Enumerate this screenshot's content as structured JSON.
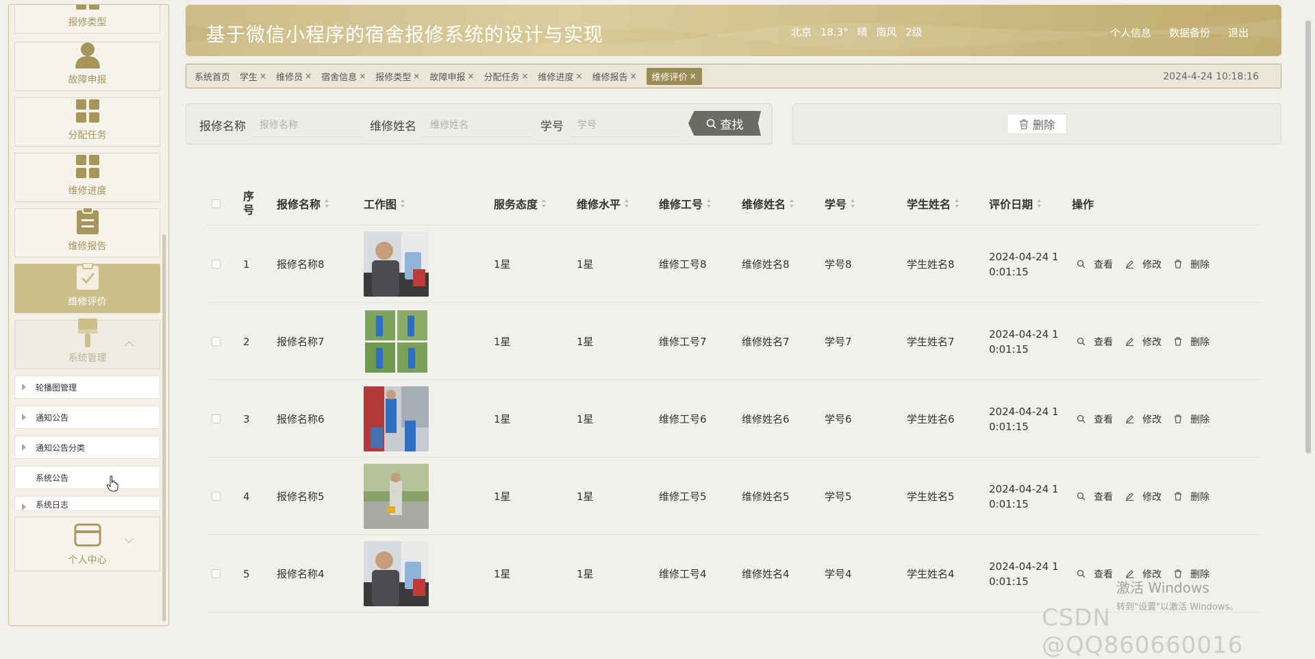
{
  "header": {
    "title": "基于微信小程序的宿舍报修系统的设计与实现",
    "weather": [
      "北京",
      "18.3°",
      "晴",
      "南风",
      "2级"
    ],
    "links": [
      "个人信息",
      "数据备份",
      "退出"
    ]
  },
  "sidebar": {
    "cards": [
      {
        "label": "报修类型",
        "icon": "grid-icon"
      },
      {
        "label": "故障申报",
        "icon": "user-icon"
      },
      {
        "label": "分配任务",
        "icon": "grid-icon"
      },
      {
        "label": "维修进度",
        "icon": "grid-icon"
      },
      {
        "label": "维修报告",
        "icon": "clipboard-icon"
      },
      {
        "label": "维修评价",
        "icon": "check-clipboard-icon",
        "active": true
      },
      {
        "label": "系统管理",
        "icon": "brush-icon",
        "expanded": true
      }
    ],
    "sub_items": [
      "轮播图管理",
      "通知公告",
      "通知公告分类",
      "系统公告",
      "系统日志"
    ],
    "bottom_card": {
      "label": "个人中心",
      "icon": "card-icon"
    }
  },
  "tabs": {
    "items": [
      {
        "label": "系统首页",
        "closable": false
      },
      {
        "label": "学生",
        "closable": true
      },
      {
        "label": "维修员",
        "closable": true
      },
      {
        "label": "宿舍信息",
        "closable": true
      },
      {
        "label": "报修类型",
        "closable": true
      },
      {
        "label": "故障申报",
        "closable": true
      },
      {
        "label": "分配任务",
        "closable": true
      },
      {
        "label": "维修进度",
        "closable": true
      },
      {
        "label": "维修报告",
        "closable": true
      },
      {
        "label": "维修评价",
        "closable": true,
        "active": true
      }
    ],
    "close_glyph": "×",
    "datetime": "2024-4-24 10:18:16"
  },
  "search": {
    "fields": [
      {
        "label": "报修名称",
        "placeholder": "报修名称"
      },
      {
        "label": "维修姓名",
        "placeholder": "维修姓名"
      },
      {
        "label": "学号",
        "placeholder": "学号"
      }
    ],
    "button": "查找"
  },
  "actions": {
    "delete": "删除"
  },
  "table": {
    "columns": [
      "序号",
      "报修名称",
      "工作图",
      "服务态度",
      "维修水平",
      "维修工号",
      "维修姓名",
      "学号",
      "学生姓名",
      "评价日期",
      "操作"
    ],
    "row_actions": [
      "查看",
      "修改",
      "删除"
    ],
    "rows": [
      {
        "no": "1",
        "name": "报修名称8",
        "attitude": "1星",
        "level": "1星",
        "staff_no": "维修工号8",
        "staff_name": "维修姓名8",
        "student_no": "学号8",
        "student_name": "学生姓名8",
        "date_line1": "2024-04-24 1",
        "date_line2": "0:01:15",
        "image": "repairman-phone"
      },
      {
        "no": "2",
        "name": "报修名称7",
        "attitude": "1星",
        "level": "1星",
        "staff_no": "维修工号7",
        "staff_name": "维修姓名7",
        "student_no": "学号7",
        "student_name": "学生姓名7",
        "date_line1": "2024-04-24 1",
        "date_line2": "0:01:15",
        "image": "workers-collage"
      },
      {
        "no": "3",
        "name": "报修名称6",
        "attitude": "1星",
        "level": "1星",
        "staff_no": "维修工号6",
        "staff_name": "维修姓名6",
        "student_no": "学号6",
        "student_name": "学生姓名6",
        "date_line1": "2024-04-24 1",
        "date_line2": "0:01:15",
        "image": "workers-street"
      },
      {
        "no": "4",
        "name": "报修名称5",
        "attitude": "1星",
        "level": "1星",
        "staff_no": "维修工号5",
        "staff_name": "维修姓名5",
        "student_no": "学号5",
        "student_name": "学生姓名5",
        "date_line1": "2024-04-24 1",
        "date_line2": "0:01:15",
        "image": "worker-walking"
      },
      {
        "no": "5",
        "name": "报修名称4",
        "attitude": "1星",
        "level": "1星",
        "staff_no": "维修工号4",
        "staff_name": "维修姓名4",
        "student_no": "学号4",
        "student_name": "学生姓名4",
        "date_line1": "2024-04-24 1",
        "date_line2": "0:01:15",
        "image": "repairman-phone"
      }
    ]
  },
  "overlay": {
    "activate_title": "激活 Windows",
    "activate_sub": "转到\"设置\"以激活 Windows。",
    "csdn": "CSDN @QQ860660016"
  },
  "colors": {
    "accent": "#cdbf8c",
    "accent_dark": "#9a8a55",
    "icon": "#a8955a"
  }
}
